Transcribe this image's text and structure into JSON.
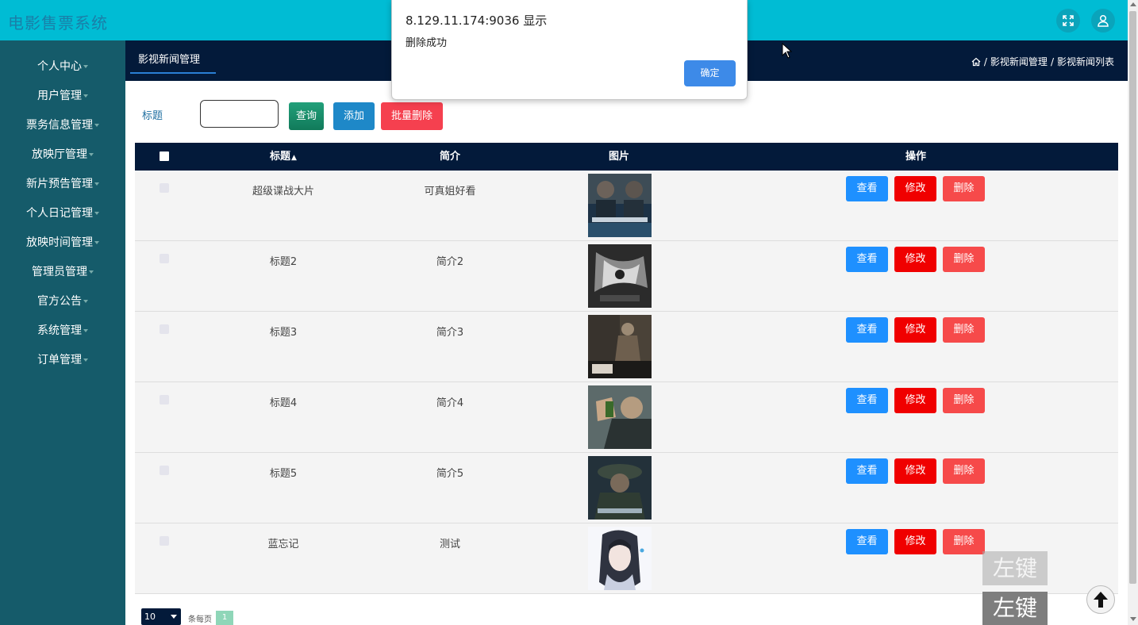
{
  "header": {
    "app_title": "电影售票系统"
  },
  "sidebar": {
    "items": [
      {
        "label": "个人中心"
      },
      {
        "label": "用户管理"
      },
      {
        "label": "票务信息管理"
      },
      {
        "label": "放映厅管理"
      },
      {
        "label": "新片预告管理"
      },
      {
        "label": "个人日记管理"
      },
      {
        "label": "放映时间管理"
      },
      {
        "label": "管理员管理"
      },
      {
        "label": "官方公告"
      },
      {
        "label": "系统管理"
      },
      {
        "label": "订单管理"
      }
    ]
  },
  "subheader": {
    "tab_label": "影视新闻管理",
    "breadcrumb": [
      "影视新闻管理",
      "影视新闻列表"
    ],
    "separator": "/"
  },
  "search": {
    "label": "标题",
    "value": "",
    "query_button": "查询",
    "add_button": "添加",
    "batch_delete_button": "批量删除"
  },
  "table": {
    "columns": {
      "title": "标题",
      "intro": "简介",
      "image": "图片",
      "actions": "操作"
    },
    "action_labels": {
      "view": "查看",
      "edit": "修改",
      "delete": "删除"
    },
    "rows": [
      {
        "title": "超级谍战大片",
        "intro": "可真姐好看",
        "image": "poster-dark-blue"
      },
      {
        "title": "标题2",
        "intro": "简介2",
        "image": "poster-shadow"
      },
      {
        "title": "标题3",
        "intro": "简介3",
        "image": "poster-fight"
      },
      {
        "title": "标题4",
        "intro": "简介4",
        "image": "poster-ipman"
      },
      {
        "title": "标题5",
        "intro": "简介5",
        "image": "poster-soldier"
      },
      {
        "title": "蓝忘记",
        "intro": "测试",
        "image": "poster-anime"
      }
    ]
  },
  "pagination": {
    "page_size": "10",
    "per_page_text": "条每页",
    "current_page": "1"
  },
  "dialog": {
    "origin": "8.129.11.174:9036 显示",
    "message": "删除成功",
    "ok_button": "确定"
  },
  "overlay": {
    "key_label": "左键"
  },
  "colors": {
    "header": "#00bcd4",
    "sidebar": "#155b6a",
    "subheader": "#031a3a",
    "view": "#1e90ff",
    "edit": "#f00000",
    "delete": "#f64a4a"
  }
}
